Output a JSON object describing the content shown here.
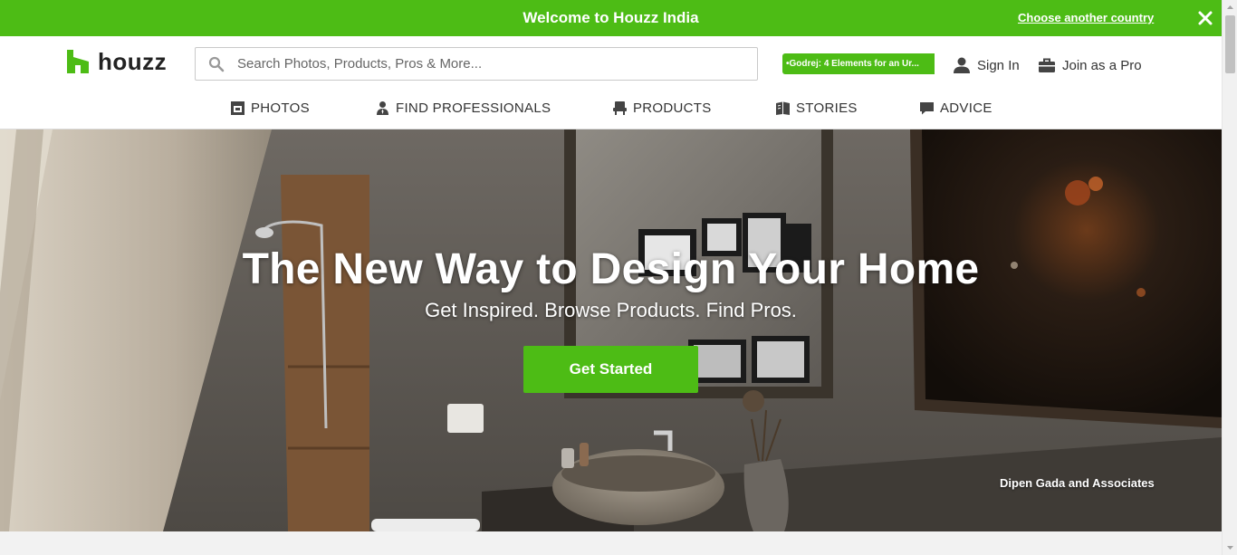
{
  "banner": {
    "title": "Welcome to Houzz India",
    "link": "Choose another country"
  },
  "header": {
    "logo_text": "houzz",
    "search_placeholder": "Search Photos, Products, Pros & More...",
    "promo": "•Godrej: 4 Elements for an Ur...",
    "sign_in": "Sign In",
    "join_pro": "Join as a Pro"
  },
  "nav": {
    "items": [
      {
        "label": "PHOTOS",
        "icon": "photos-icon"
      },
      {
        "label": "FIND PROFESSIONALS",
        "icon": "professional-icon"
      },
      {
        "label": "PRODUCTS",
        "icon": "chair-icon"
      },
      {
        "label": "STORIES",
        "icon": "book-icon"
      },
      {
        "label": "ADVICE",
        "icon": "speech-bubble-icon"
      }
    ]
  },
  "hero": {
    "title": "The New Way to Design Your Home",
    "subtitle": "Get Inspired. Browse Products. Find Pros.",
    "cta": "Get Started",
    "credit": "Dipen Gada and Associates"
  },
  "colors": {
    "brand_green": "#4dbc15",
    "text_dark": "#333333"
  }
}
